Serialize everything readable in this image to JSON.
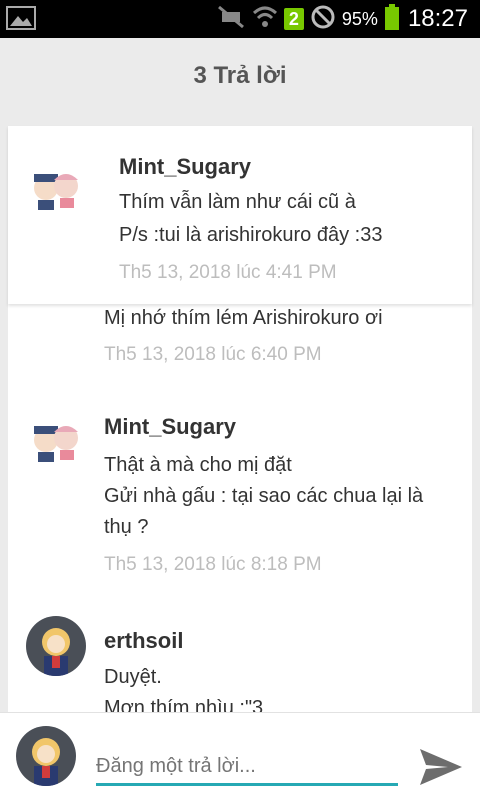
{
  "status_bar": {
    "battery_percent": "95%",
    "time": "18:27",
    "signal_badge": "2",
    "icons": [
      "image-icon",
      "mute-icon",
      "wifi-icon",
      "signal-badge-icon",
      "blocked-icon",
      "battery-icon"
    ]
  },
  "header": {
    "title": "3 Trả lời"
  },
  "comments": [
    {
      "author": "Mint_Sugary",
      "lines": [
        "Thím vẫn làm như cái cũ à",
        "P/s :tui là arishirokuro đây :33"
      ],
      "time": "Th5 13, 2018 lúc 4:41 PM"
    },
    {
      "author": "",
      "lines": [
        "Mị nhớ thím lém Arishirokuro ơi"
      ],
      "time": "Th5 13, 2018 lúc 6:40 PM"
    },
    {
      "author": "Mint_Sugary",
      "lines": [
        "Thật à mà cho mị đặt",
        "Gửi nhà gấu : tại sao các chua lại là",
        "thụ ?"
      ],
      "time": "Th5 13, 2018 lúc 8:18 PM"
    },
    {
      "author": "erthsoil",
      "lines": [
        "Duyệt.",
        "Mợn thím nhìu :\"3"
      ],
      "time": ""
    }
  ],
  "compose": {
    "placeholder": "Đăng một trả lời..."
  },
  "colors": {
    "accent": "#26a9b4",
    "battery": "#78c800"
  }
}
